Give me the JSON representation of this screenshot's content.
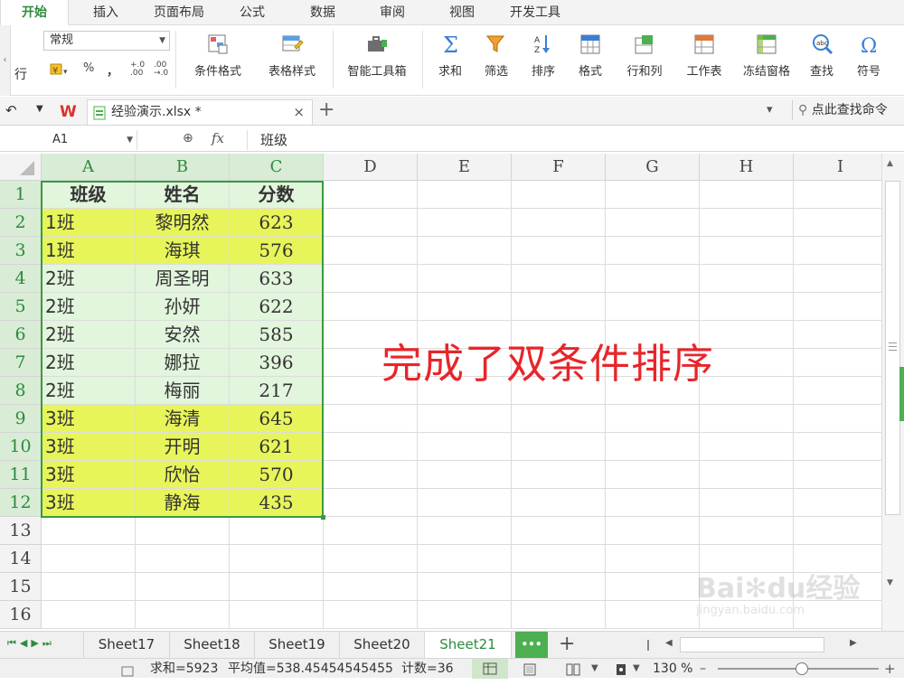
{
  "menu": {
    "tabs": [
      "开始",
      "插入",
      "页面布局",
      "公式",
      "数据",
      "审阅",
      "视图",
      "开发工具"
    ],
    "active_index": 0
  },
  "ribbon": {
    "left_label": "行",
    "number_format": "常规",
    "pct_symbol": "%",
    "comma_symbol": "，",
    "buttons": {
      "cond_format": "条件格式",
      "table_style": "表格样式",
      "smart_toolbox": "智能工具箱",
      "sum": "求和",
      "filter": "筛选",
      "sort": "排序",
      "format": "格式",
      "row_col": "行和列",
      "worksheet": "工作表",
      "freeze": "冻结窗格",
      "find": "查找",
      "symbol": "符号"
    },
    "accent": "#2e8b3d"
  },
  "tabstrip": {
    "doc_name": "经验演示.xlsx *",
    "search_hint": "点此查找命令"
  },
  "formula_bar": {
    "name_box": "A1",
    "fx_label": "fx",
    "content": "班级"
  },
  "grid": {
    "columns": [
      "A",
      "B",
      "C",
      "D",
      "E",
      "F",
      "G",
      "H",
      "I"
    ],
    "rows": [
      "1",
      "2",
      "3",
      "4",
      "5",
      "6",
      "7",
      "8",
      "9",
      "10",
      "11",
      "12",
      "13",
      "14",
      "15",
      "16"
    ],
    "header": [
      "班级",
      "姓名",
      "分数"
    ],
    "data": [
      [
        "1班",
        "黎明然",
        "623"
      ],
      [
        "1班",
        "海琪",
        "576"
      ],
      [
        "2班",
        "周圣明",
        "633"
      ],
      [
        "2班",
        "孙妍",
        "622"
      ],
      [
        "2班",
        "安然",
        "585"
      ],
      [
        "2班",
        "娜拉",
        "396"
      ],
      [
        "2班",
        "梅丽",
        "217"
      ],
      [
        "3班",
        "海清",
        "645"
      ],
      [
        "3班",
        "开明",
        "621"
      ],
      [
        "3班",
        "欣怡",
        "570"
      ],
      [
        "3班",
        "静海",
        "435"
      ]
    ],
    "fill_colors": {
      "header": "#e2f5dd",
      "group_bright": "#e8f55a",
      "group_light": "#e2f5dd",
      "border": "#3a9a3f"
    },
    "annotation": "完成了双条件排序",
    "annotation_color": "#e8252a"
  },
  "sheets": {
    "tabs": [
      "Sheet17",
      "Sheet18",
      "Sheet19",
      "Sheet20",
      "Sheet21"
    ],
    "active_index": 4,
    "more": "•••",
    "add": "+"
  },
  "status": {
    "sum": "求和=5923",
    "avg": "平均值=538.45454545455",
    "count": "计数=36",
    "zoom": "130 %"
  },
  "watermark": {
    "line1": "Bai",
    "line2": "du",
    "line3": "经验",
    "url": "jingyan.baidu.com"
  }
}
